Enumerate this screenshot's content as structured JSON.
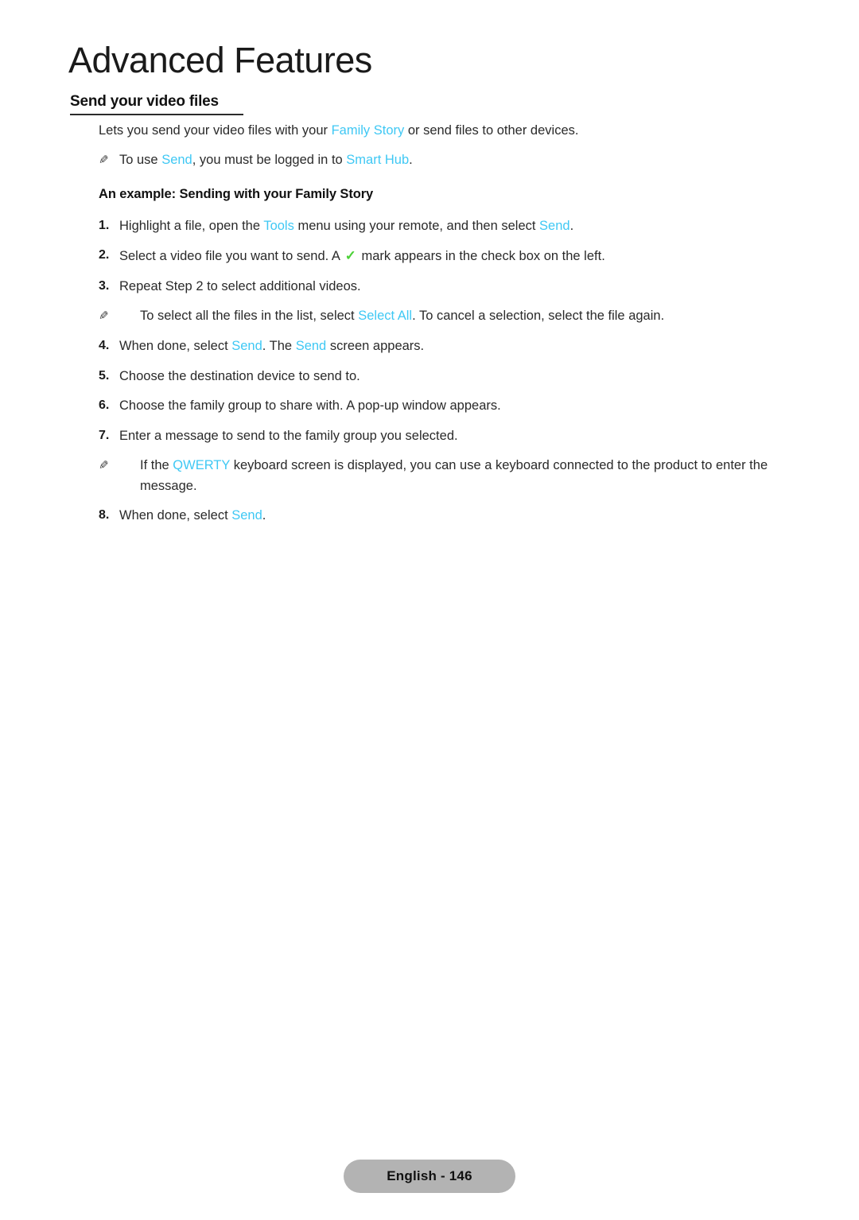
{
  "chapter": {
    "title": "Advanced Features"
  },
  "section": {
    "heading": "Send your video files"
  },
  "intro": {
    "text_before": "Lets you send your video files with your ",
    "link": "Family Story",
    "text_after": " or send files to other devices."
  },
  "intro_note": {
    "icon": "pencil-icon",
    "t1": "To use ",
    "l1": "Send",
    "t2": ", you must be logged in to ",
    "l2": "Smart Hub",
    "t3": "."
  },
  "subheading": "An example: Sending with your Family Story",
  "steps": [
    {
      "num": "1.",
      "t1": "Highlight a file, open the ",
      "l1": "Tools",
      "t2": " menu using your remote, and then select ",
      "l2": "Send",
      "t3": "."
    },
    {
      "num": "2.",
      "t1": "Select a video file you want to send. A ",
      "check": "✓",
      "t2": " mark appears in the check box on the left."
    },
    {
      "num": "3.",
      "t1": "Repeat Step 2 to select additional videos."
    },
    {
      "is_note": true,
      "icon": "pencil-icon",
      "t1": "To select all the files in the list, select ",
      "l1": "Select All",
      "t2": ". To cancel a selection, select the file again."
    },
    {
      "num": "4.",
      "t1": "When done, select ",
      "l1": "Send",
      "t2": ". The ",
      "l2": "Send",
      "t3": " screen appears."
    },
    {
      "num": "5.",
      "t1": "Choose the destination device to send to."
    },
    {
      "num": "6.",
      "t1": "Choose the family group to share with. A pop-up window appears."
    },
    {
      "num": "7.",
      "t1": "Enter a message to send to the family group you selected."
    },
    {
      "is_note": true,
      "icon": "pencil-icon",
      "t1": "If the ",
      "l1": "QWERTY",
      "t2": " keyboard screen is displayed, you can use a keyboard connected to the product to enter the message."
    },
    {
      "num": "8.",
      "t1": "When done, select ",
      "l1": "Send",
      "t2": "."
    }
  ],
  "footer": {
    "page_label": "English - 146"
  },
  "colors": {
    "link": "#3fc8f4",
    "check": "#4cd137",
    "badge_bg": "#b3b3b3",
    "text": "#2a2a2a"
  }
}
